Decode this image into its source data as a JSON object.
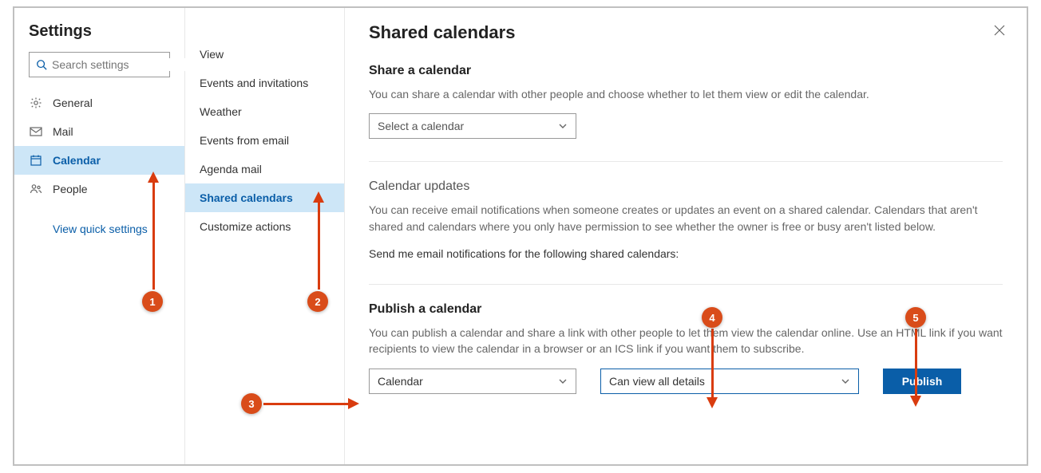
{
  "sidebar1": {
    "title": "Settings",
    "search_placeholder": "Search settings",
    "items": [
      {
        "label": "General"
      },
      {
        "label": "Mail"
      },
      {
        "label": "Calendar"
      },
      {
        "label": "People"
      }
    ],
    "quick_link": "View quick settings"
  },
  "sidebar2": {
    "items": [
      {
        "label": "View"
      },
      {
        "label": "Events and invitations"
      },
      {
        "label": "Weather"
      },
      {
        "label": "Events from email"
      },
      {
        "label": "Agenda mail"
      },
      {
        "label": "Shared calendars"
      },
      {
        "label": "Customize actions"
      }
    ]
  },
  "main": {
    "heading": "Shared calendars",
    "share": {
      "title": "Share a calendar",
      "desc": "You can share a calendar with other people and choose whether to let them view or edit the calendar.",
      "select_placeholder": "Select a calendar"
    },
    "updates": {
      "title": "Calendar updates",
      "desc": "You can receive email notifications when someone creates or updates an event on a shared calendar. Calendars that aren't shared and calendars where you only have permission to see whether the owner is free or busy aren't listed below.",
      "prompt": "Send me email notifications for the following shared calendars:"
    },
    "publish": {
      "title": "Publish a calendar",
      "desc": "You can publish a calendar and share a link with other people to let them view the calendar online. Use an HTML link if you want recipients to view the calendar in a browser or an ICS link if you want them to subscribe.",
      "select1": "Calendar",
      "select2": "Can view all details",
      "button": "Publish"
    }
  },
  "annotations": [
    "1",
    "2",
    "3",
    "4",
    "5"
  ]
}
